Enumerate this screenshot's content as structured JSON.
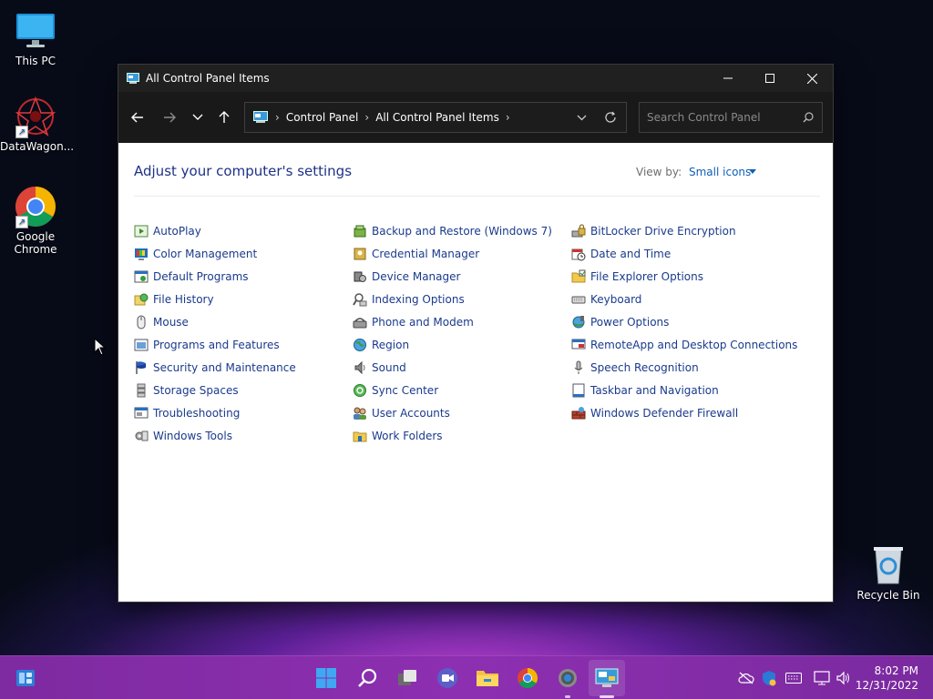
{
  "desktop": {
    "icons": [
      {
        "label": "This PC"
      },
      {
        "label": "DataWagon..."
      },
      {
        "label": "Google Chrome"
      },
      {
        "label": "Recycle Bin"
      }
    ]
  },
  "window": {
    "title": "All Control Panel Items",
    "address": {
      "crumbs": [
        "Control Panel",
        "All Control Panel Items"
      ]
    },
    "search_placeholder": "Search Control Panel",
    "heading": "Adjust your computer's settings",
    "view_by_label": "View by:",
    "view_by_value": "Small icons",
    "columns": [
      [
        "AutoPlay",
        "Color Management",
        "Default Programs",
        "File History",
        "Mouse",
        "Programs and Features",
        "Security and Maintenance",
        "Storage Spaces",
        "Troubleshooting",
        "Windows Tools"
      ],
      [
        "Backup and Restore (Windows 7)",
        "Credential Manager",
        "Device Manager",
        "Indexing Options",
        "Phone and Modem",
        "Region",
        "Sound",
        "Sync Center",
        "User Accounts",
        "Work Folders"
      ],
      [
        "BitLocker Drive Encryption",
        "Date and Time",
        "File Explorer Options",
        "Keyboard",
        "Power Options",
        "RemoteApp and Desktop Connections",
        "Speech Recognition",
        "Taskbar and Navigation",
        "Windows Defender Firewall"
      ]
    ]
  },
  "taskbar": {
    "time": "8:02 PM",
    "date": "12/31/2022"
  },
  "colors": {
    "link": "#1a3a8c",
    "heading": "#1e3287",
    "accent": "#0f5fb8",
    "taskbar": "#8d2fb1"
  }
}
